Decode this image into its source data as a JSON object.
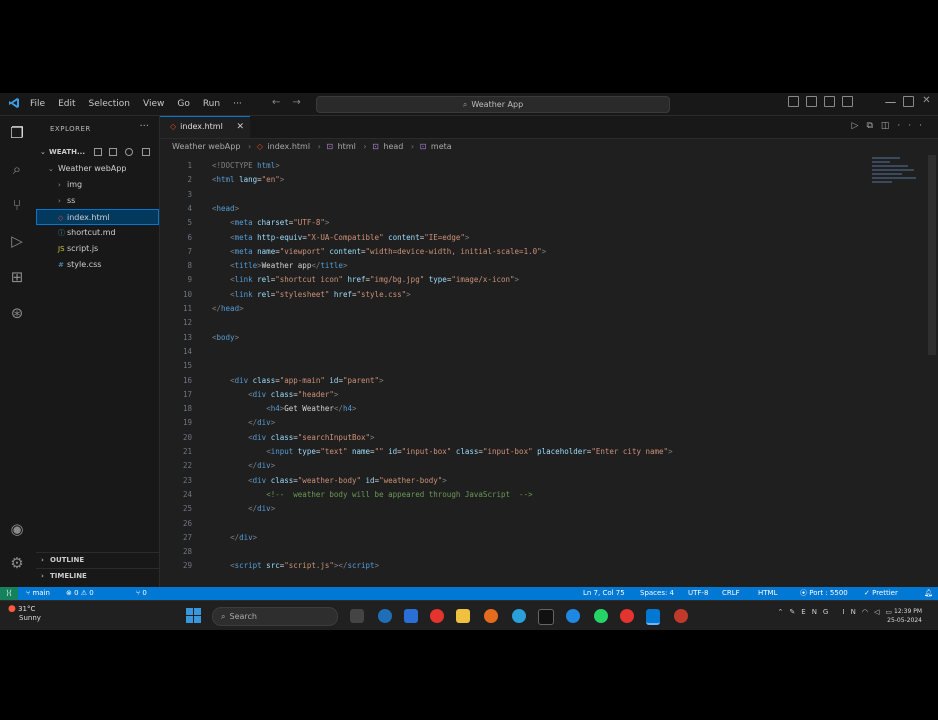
{
  "titlebar": {
    "menu": [
      "File",
      "Edit",
      "Selection",
      "View",
      "Go",
      "Run",
      "···"
    ],
    "search_text": "Weather App"
  },
  "sidebar": {
    "header": "EXPLORER",
    "folder_root": "WEATH...",
    "project": "Weather webApp",
    "items": [
      {
        "name": "img",
        "type": "folder"
      },
      {
        "name": "ss",
        "type": "folder"
      },
      {
        "name": "index.html",
        "type": "file",
        "selected": true
      },
      {
        "name": "shortcut.md",
        "type": "file"
      },
      {
        "name": "script.js",
        "type": "file"
      },
      {
        "name": "style.css",
        "type": "file"
      }
    ],
    "outline": "OUTLINE",
    "timeline": "TIMELINE"
  },
  "editor": {
    "tab_label": "index.html",
    "breadcrumb": [
      "Weather webApp",
      "index.html",
      "html",
      "head",
      "meta"
    ],
    "lines": [
      {
        "n": "1",
        "segments": [
          {
            "c": "t",
            "s": "<!DOCTYPE "
          },
          {
            "c": "tag",
            "s": "html"
          },
          {
            "c": "t",
            "s": ">"
          }
        ]
      },
      {
        "n": "2",
        "segments": [
          {
            "c": "t",
            "s": "<"
          },
          {
            "c": "tag",
            "s": "html"
          },
          {
            "c": "attr",
            "s": " lang"
          },
          {
            "c": "txt",
            "s": "="
          },
          {
            "c": "str",
            "s": "\"en\""
          },
          {
            "c": "t",
            "s": ">"
          }
        ]
      },
      {
        "n": "3",
        "segments": []
      },
      {
        "n": "4",
        "segments": [
          {
            "c": "t",
            "s": "<"
          },
          {
            "c": "tag",
            "s": "head"
          },
          {
            "c": "t",
            "s": ">"
          }
        ]
      },
      {
        "n": "5",
        "segments": [
          {
            "c": "txt",
            "s": "    "
          },
          {
            "c": "t",
            "s": "<"
          },
          {
            "c": "tag",
            "s": "meta"
          },
          {
            "c": "attr",
            "s": " charset"
          },
          {
            "c": "txt",
            "s": "="
          },
          {
            "c": "str",
            "s": "\"UTF-8\""
          },
          {
            "c": "t",
            "s": ">"
          }
        ]
      },
      {
        "n": "6",
        "segments": [
          {
            "c": "txt",
            "s": "    "
          },
          {
            "c": "t",
            "s": "<"
          },
          {
            "c": "tag",
            "s": "meta"
          },
          {
            "c": "attr",
            "s": " http-equiv"
          },
          {
            "c": "txt",
            "s": "="
          },
          {
            "c": "str",
            "s": "\"X-UA-Compatible\""
          },
          {
            "c": "attr",
            "s": " content"
          },
          {
            "c": "txt",
            "s": "="
          },
          {
            "c": "str",
            "s": "\"IE=edge\""
          },
          {
            "c": "t",
            "s": ">"
          }
        ]
      },
      {
        "n": "7",
        "segments": [
          {
            "c": "txt",
            "s": "    "
          },
          {
            "c": "t",
            "s": "<"
          },
          {
            "c": "tag",
            "s": "meta"
          },
          {
            "c": "attr",
            "s": " name"
          },
          {
            "c": "txt",
            "s": "="
          },
          {
            "c": "str",
            "s": "\"viewport\""
          },
          {
            "c": "attr",
            "s": " content"
          },
          {
            "c": "txt",
            "s": "="
          },
          {
            "c": "str",
            "s": "\"width=device-width, initial-scale=1.0\""
          },
          {
            "c": "t",
            "s": ">"
          }
        ]
      },
      {
        "n": "8",
        "segments": [
          {
            "c": "txt",
            "s": "    "
          },
          {
            "c": "t",
            "s": "<"
          },
          {
            "c": "tag",
            "s": "title"
          },
          {
            "c": "t",
            "s": ">"
          },
          {
            "c": "txt",
            "s": "Weather app"
          },
          {
            "c": "t",
            "s": "</"
          },
          {
            "c": "tag",
            "s": "title"
          },
          {
            "c": "t",
            "s": ">"
          }
        ]
      },
      {
        "n": "9",
        "segments": [
          {
            "c": "txt",
            "s": "    "
          },
          {
            "c": "t",
            "s": "<"
          },
          {
            "c": "tag",
            "s": "link"
          },
          {
            "c": "attr",
            "s": " rel"
          },
          {
            "c": "txt",
            "s": "="
          },
          {
            "c": "str",
            "s": "\"shortcut icon\""
          },
          {
            "c": "attr",
            "s": " href"
          },
          {
            "c": "txt",
            "s": "="
          },
          {
            "c": "str",
            "s": "\"img/bg.jpg\""
          },
          {
            "c": "attr",
            "s": " type"
          },
          {
            "c": "txt",
            "s": "="
          },
          {
            "c": "str",
            "s": "\"image/x-icon\""
          },
          {
            "c": "t",
            "s": ">"
          }
        ]
      },
      {
        "n": "10",
        "segments": [
          {
            "c": "txt",
            "s": "    "
          },
          {
            "c": "t",
            "s": "<"
          },
          {
            "c": "tag",
            "s": "link"
          },
          {
            "c": "attr",
            "s": " rel"
          },
          {
            "c": "txt",
            "s": "="
          },
          {
            "c": "str",
            "s": "\"stylesheet\""
          },
          {
            "c": "attr",
            "s": " href"
          },
          {
            "c": "txt",
            "s": "="
          },
          {
            "c": "str",
            "s": "\"style.css\""
          },
          {
            "c": "t",
            "s": ">"
          }
        ]
      },
      {
        "n": "11",
        "segments": [
          {
            "c": "t",
            "s": "</"
          },
          {
            "c": "tag",
            "s": "head"
          },
          {
            "c": "t",
            "s": ">"
          }
        ]
      },
      {
        "n": "12",
        "segments": []
      },
      {
        "n": "13",
        "segments": [
          {
            "c": "t",
            "s": "<"
          },
          {
            "c": "tag",
            "s": "body"
          },
          {
            "c": "t",
            "s": ">"
          }
        ]
      },
      {
        "n": "14",
        "segments": []
      },
      {
        "n": "15",
        "segments": []
      },
      {
        "n": "16",
        "segments": [
          {
            "c": "txt",
            "s": "    "
          },
          {
            "c": "t",
            "s": "<"
          },
          {
            "c": "tag",
            "s": "div"
          },
          {
            "c": "attr",
            "s": " class"
          },
          {
            "c": "txt",
            "s": "="
          },
          {
            "c": "str",
            "s": "\"app-main\""
          },
          {
            "c": "attr",
            "s": " id"
          },
          {
            "c": "txt",
            "s": "="
          },
          {
            "c": "str",
            "s": "\"parent\""
          },
          {
            "c": "t",
            "s": ">"
          }
        ]
      },
      {
        "n": "17",
        "segments": [
          {
            "c": "txt",
            "s": "        "
          },
          {
            "c": "t",
            "s": "<"
          },
          {
            "c": "tag",
            "s": "div"
          },
          {
            "c": "attr",
            "s": " class"
          },
          {
            "c": "txt",
            "s": "="
          },
          {
            "c": "str",
            "s": "\"header\""
          },
          {
            "c": "t",
            "s": ">"
          }
        ]
      },
      {
        "n": "18",
        "segments": [
          {
            "c": "txt",
            "s": "            "
          },
          {
            "c": "t",
            "s": "<"
          },
          {
            "c": "tag",
            "s": "h4"
          },
          {
            "c": "t",
            "s": ">"
          },
          {
            "c": "txt",
            "s": "Get Weather"
          },
          {
            "c": "t",
            "s": "</"
          },
          {
            "c": "tag",
            "s": "h4"
          },
          {
            "c": "t",
            "s": ">"
          }
        ]
      },
      {
        "n": "19",
        "segments": [
          {
            "c": "txt",
            "s": "        "
          },
          {
            "c": "t",
            "s": "</"
          },
          {
            "c": "tag",
            "s": "div"
          },
          {
            "c": "t",
            "s": ">"
          }
        ]
      },
      {
        "n": "20",
        "segments": [
          {
            "c": "txt",
            "s": "        "
          },
          {
            "c": "t",
            "s": "<"
          },
          {
            "c": "tag",
            "s": "div"
          },
          {
            "c": "attr",
            "s": " class"
          },
          {
            "c": "txt",
            "s": "="
          },
          {
            "c": "str",
            "s": "\"searchInputBox\""
          },
          {
            "c": "t",
            "s": ">"
          }
        ]
      },
      {
        "n": "21",
        "segments": [
          {
            "c": "txt",
            "s": "            "
          },
          {
            "c": "t",
            "s": "<"
          },
          {
            "c": "tag",
            "s": "input"
          },
          {
            "c": "attr",
            "s": " type"
          },
          {
            "c": "txt",
            "s": "="
          },
          {
            "c": "str",
            "s": "\"text\""
          },
          {
            "c": "attr",
            "s": " name"
          },
          {
            "c": "txt",
            "s": "="
          },
          {
            "c": "str",
            "s": "\"\""
          },
          {
            "c": "attr",
            "s": " id"
          },
          {
            "c": "txt",
            "s": "="
          },
          {
            "c": "str",
            "s": "\"input-box\""
          },
          {
            "c": "attr",
            "s": " class"
          },
          {
            "c": "txt",
            "s": "="
          },
          {
            "c": "str",
            "s": "\"input-box\""
          },
          {
            "c": "attr",
            "s": " placeholder"
          },
          {
            "c": "txt",
            "s": "="
          },
          {
            "c": "str",
            "s": "\"Enter city name\""
          },
          {
            "c": "t",
            "s": ">"
          }
        ]
      },
      {
        "n": "22",
        "segments": [
          {
            "c": "txt",
            "s": "        "
          },
          {
            "c": "t",
            "s": "</"
          },
          {
            "c": "tag",
            "s": "div"
          },
          {
            "c": "t",
            "s": ">"
          }
        ]
      },
      {
        "n": "23",
        "segments": [
          {
            "c": "txt",
            "s": "        "
          },
          {
            "c": "t",
            "s": "<"
          },
          {
            "c": "tag",
            "s": "div"
          },
          {
            "c": "attr",
            "s": " class"
          },
          {
            "c": "txt",
            "s": "="
          },
          {
            "c": "str",
            "s": "\"weather-body\""
          },
          {
            "c": "attr",
            "s": " id"
          },
          {
            "c": "txt",
            "s": "="
          },
          {
            "c": "str",
            "s": "\"weather-body\""
          },
          {
            "c": "t",
            "s": ">"
          }
        ]
      },
      {
        "n": "24",
        "segments": [
          {
            "c": "txt",
            "s": "            "
          },
          {
            "c": "cm",
            "s": "<!--  weather body will be appeared through JavaScript  -->"
          }
        ]
      },
      {
        "n": "25",
        "segments": [
          {
            "c": "txt",
            "s": "        "
          },
          {
            "c": "t",
            "s": "</"
          },
          {
            "c": "tag",
            "s": "div"
          },
          {
            "c": "t",
            "s": ">"
          }
        ]
      },
      {
        "n": "26",
        "segments": []
      },
      {
        "n": "27",
        "segments": [
          {
            "c": "txt",
            "s": "    "
          },
          {
            "c": "t",
            "s": "</"
          },
          {
            "c": "tag",
            "s": "div"
          },
          {
            "c": "t",
            "s": ">"
          }
        ]
      },
      {
        "n": "28",
        "segments": []
      },
      {
        "n": "29",
        "segments": [
          {
            "c": "txt",
            "s": "    "
          },
          {
            "c": "t",
            "s": "<"
          },
          {
            "c": "tag",
            "s": "script"
          },
          {
            "c": "attr",
            "s": " src"
          },
          {
            "c": "txt",
            "s": "="
          },
          {
            "c": "str",
            "s": "\"script.js\""
          },
          {
            "c": "t",
            "s": "></"
          },
          {
            "c": "tag",
            "s": "script"
          },
          {
            "c": "t",
            "s": ">"
          }
        ]
      }
    ]
  },
  "statusbar": {
    "branch": "main",
    "problems": "⊗ 0 ⚠ 0",
    "ports": "⑂ 0",
    "position": "Ln 7, Col 75",
    "spaces": "Spaces: 4",
    "encoding": "UTF-8",
    "eol": "CRLF",
    "language": "HTML",
    "port": "Port : 5500",
    "formatter": "Prettier"
  },
  "taskbar": {
    "weather_temp": "31°C",
    "weather_desc": "Sunny",
    "search_placeholder": "Search",
    "lang": "ENG IN",
    "time": "12:39 PM",
    "date": "25-05-2024"
  }
}
